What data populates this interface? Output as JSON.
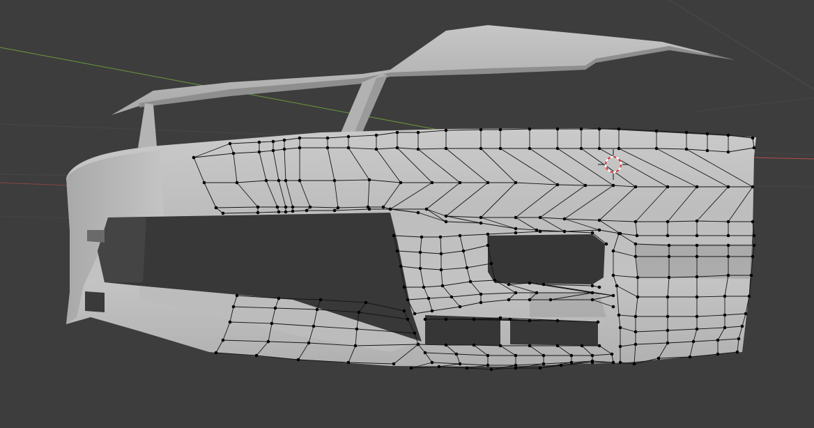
{
  "viewport": {
    "background_color": "#3d3d3d",
    "grid_color": "#4c4c4c",
    "x_axis_color": "#b84c4c",
    "y_axis_color": "#6a9a3a"
  },
  "mesh": {
    "surface_color": "#b8b8b8",
    "surface_highlight": "#cfcfcf",
    "surface_shadow": "#8c8c8c",
    "opening_color": "#383838",
    "edge_color": "#141414",
    "vertex_color": "#000000"
  },
  "cursor": {
    "icon": "3d-cursor-icon",
    "ring_color_1": "#d43c3c",
    "ring_color_2": "#ffffff"
  }
}
